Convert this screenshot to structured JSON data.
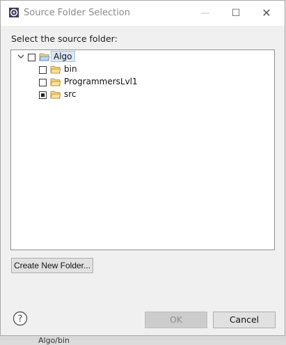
{
  "dialog": {
    "title": "Source Folder Selection",
    "prompt": "Select the source folder:",
    "window_controls": {
      "minimize": "—",
      "maximize": "☐",
      "close": "✕"
    }
  },
  "tree": {
    "root": {
      "label": "Algo",
      "expanded": true,
      "checked": false
    },
    "children": [
      {
        "label": "bin",
        "checked": false
      },
      {
        "label": "ProgrammersLvl1",
        "checked": false
      },
      {
        "label": "src",
        "checked": "partial"
      }
    ]
  },
  "buttons": {
    "create_folder": "Create New Folder...",
    "ok": "OK",
    "cancel": "Cancel",
    "help": "?"
  },
  "background": {
    "bottom_text": "Algo/bin"
  }
}
